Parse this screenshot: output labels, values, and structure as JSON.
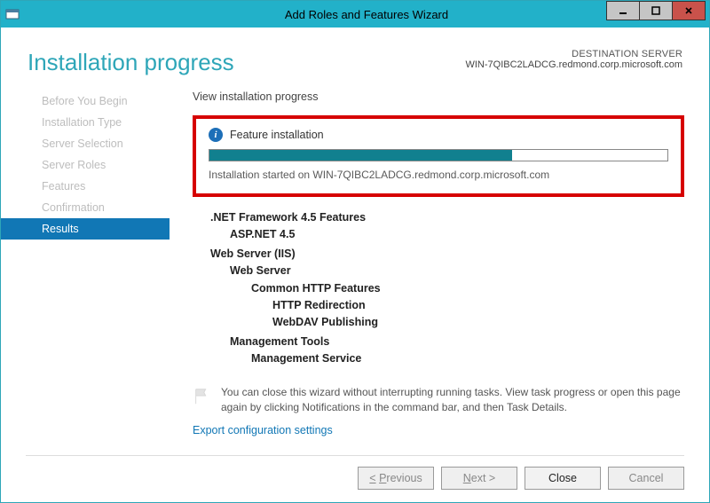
{
  "window": {
    "title": "Add Roles and Features Wizard"
  },
  "header": {
    "page_title": "Installation progress",
    "dest_label": "DESTINATION SERVER",
    "dest_server": "WIN-7QIBC2LADCG.redmond.corp.microsoft.com"
  },
  "sidebar": {
    "items": [
      {
        "label": "Before You Begin"
      },
      {
        "label": "Installation Type"
      },
      {
        "label": "Server Selection"
      },
      {
        "label": "Server Roles"
      },
      {
        "label": "Features"
      },
      {
        "label": "Confirmation"
      },
      {
        "label": "Results"
      }
    ],
    "active_index": 6
  },
  "main": {
    "view_label": "View installation progress",
    "progress": {
      "title": "Feature installation",
      "percent": 66,
      "status": "Installation started on WIN-7QIBC2LADCG.redmond.corp.microsoft.com"
    },
    "tree": {
      "net_group": ".NET Framework 4.5 Features",
      "aspnet": "ASP.NET 4.5",
      "web_group": "Web Server (IIS)",
      "web_server": "Web Server",
      "common_http": "Common HTTP Features",
      "http_redir": "HTTP Redirection",
      "webdav": "WebDAV Publishing",
      "mgmt_tools": "Management Tools",
      "mgmt_svc": "Management Service"
    },
    "info_text": "You can close this wizard without interrupting running tasks. View task progress or open this page again by clicking Notifications in the command bar, and then Task Details.",
    "export_link": "Export configuration settings"
  },
  "footer": {
    "previous": "< Previous",
    "next": "Next >",
    "close": "Close",
    "cancel": "Cancel"
  }
}
